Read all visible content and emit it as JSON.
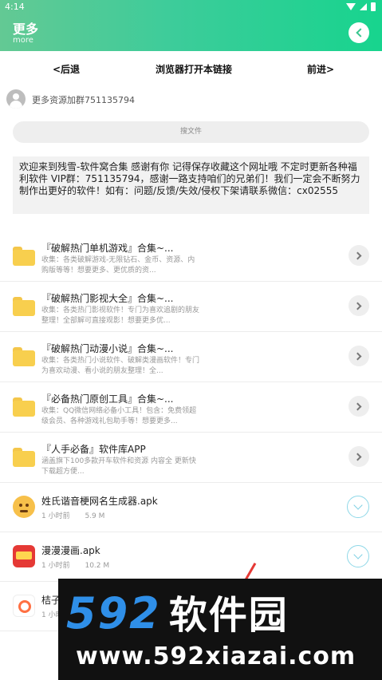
{
  "status": {
    "time": "4:14"
  },
  "header": {
    "title": "更多",
    "subtitle": "more"
  },
  "nav": {
    "back": "<后退",
    "open_in_browser": "浏览器打开本链接",
    "forward": "前进>"
  },
  "group": {
    "text": "更多资源加群751135794"
  },
  "search": {
    "placeholder": "搜文件"
  },
  "notice": {
    "text": "欢迎来到残雪-软件窝合集 感谢有你 记得保存收藏这个网址哦 不定时更新各种福利软件 VIP群：751135794，感谢一路支持咱们的兄弟们！我们一定会不断努力制作出更好的软件！如有：问题/反馈/失效/侵权下架请联系微信：cx02555"
  },
  "folders": [
    {
      "title": "『破解热门单机游戏』合集~...",
      "desc": "收集：各类破解游戏-无限钻石、金币、资源、内购版等等！想要更多、更优质的资..."
    },
    {
      "title": "『破解热门影视大全』合集~...",
      "desc": "收集：各类热门影视软件！专门为喜欢追剧的朋友整理！全部解可直接观影！想要更多优..."
    },
    {
      "title": "『破解热门动漫小说』合集~...",
      "desc": "收集：各类热门小说软件、破解类漫画软件！专门为喜欢动漫、看小说的朋友整理！全..."
    },
    {
      "title": "『必备热门原创工具』合集~...",
      "desc": "收集：QQ微信网络必备小工具！包含：免费领超级会员、各种游戏礼包助手等！想要更多..."
    },
    {
      "title": "『人手必备』软件库APP",
      "desc": "涵盖旗下100多款开车软件和资源 内容全 更新快 下载超方便..."
    }
  ],
  "files": [
    {
      "title": "姓氏谐音梗网名生成器.apk",
      "time": "1 小时前",
      "size": "5.9 M",
      "icon": "emoji-face-icon"
    },
    {
      "title": "漫漫漫画.apk",
      "time": "1 小时前",
      "size": "10.2 M",
      "icon": "manga-app-icon"
    },
    {
      "title": "桔子",
      "time": "1 小时",
      "size": "",
      "icon": "orange-app-icon"
    }
  ],
  "watermark": {
    "line1_num": "592",
    "line1_cn": "软件园",
    "line2": "www.592xiazai.com"
  }
}
